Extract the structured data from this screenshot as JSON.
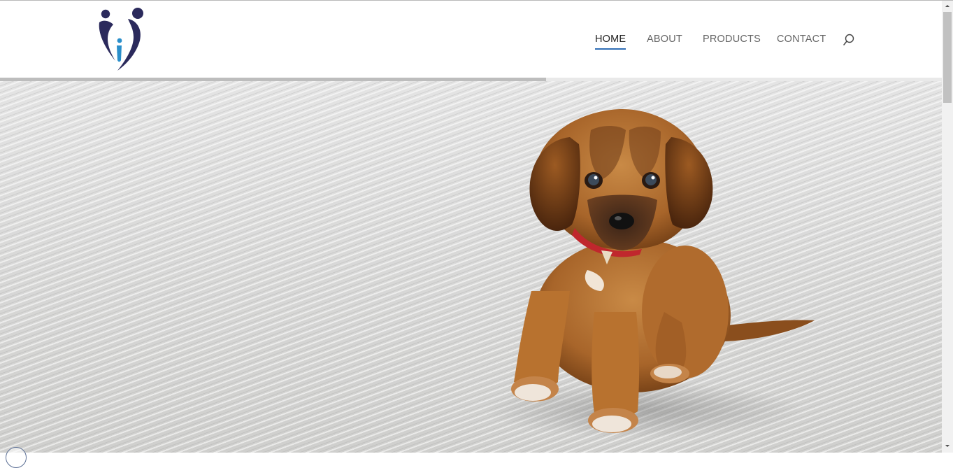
{
  "brand": {
    "logo_icon": "family-heart-logo",
    "colors": {
      "dark": "#2b2a5c",
      "light": "#2a8fcb"
    }
  },
  "nav": {
    "items": [
      {
        "label": "HOME",
        "active": true
      },
      {
        "label": "ABOUT",
        "active": false
      },
      {
        "label": "PRODUCTS",
        "active": false
      },
      {
        "label": "CONTACT",
        "active": false
      }
    ],
    "search_icon": "search-icon",
    "accent_color": "#2f6db5"
  },
  "hero": {
    "subject": "puppy-on-carpet",
    "progress": 0.58
  },
  "floating_badge_icon": "circle-badge-icon"
}
